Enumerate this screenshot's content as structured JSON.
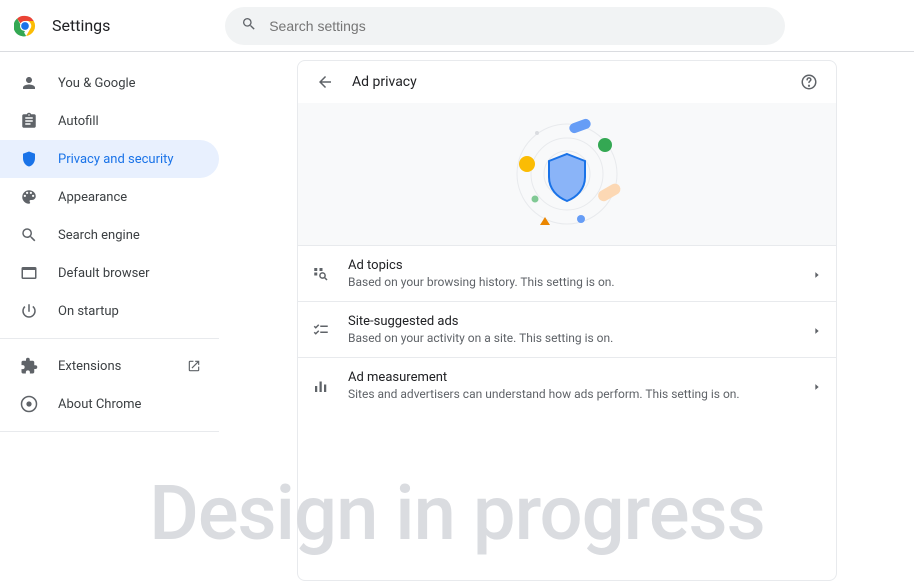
{
  "header": {
    "title": "Settings",
    "search_placeholder": "Search settings"
  },
  "sidebar": {
    "items": [
      {
        "label": "You & Google",
        "icon": "person"
      },
      {
        "label": "Autofill",
        "icon": "autofill"
      },
      {
        "label": "Privacy and security",
        "icon": "shield",
        "active": true
      },
      {
        "label": "Appearance",
        "icon": "palette"
      },
      {
        "label": "Search engine",
        "icon": "search"
      },
      {
        "label": "Default browser",
        "icon": "browser"
      },
      {
        "label": "On startup",
        "icon": "power"
      }
    ],
    "extra": [
      {
        "label": "Extensions",
        "icon": "extension",
        "external": true
      },
      {
        "label": "About Chrome",
        "icon": "chrome"
      }
    ]
  },
  "page": {
    "title": "Ad privacy",
    "rows": [
      {
        "title": "Ad topics",
        "sub": "Based on your browsing history. This setting is on.",
        "icon": "topics"
      },
      {
        "title": "Site-suggested ads",
        "sub": "Based on your activity on a site. This setting is on.",
        "icon": "checklist"
      },
      {
        "title": "Ad measurement",
        "sub": "Sites and advertisers can understand how ads perform. This setting is on.",
        "icon": "barchart"
      }
    ]
  },
  "watermark": "Design in progress"
}
